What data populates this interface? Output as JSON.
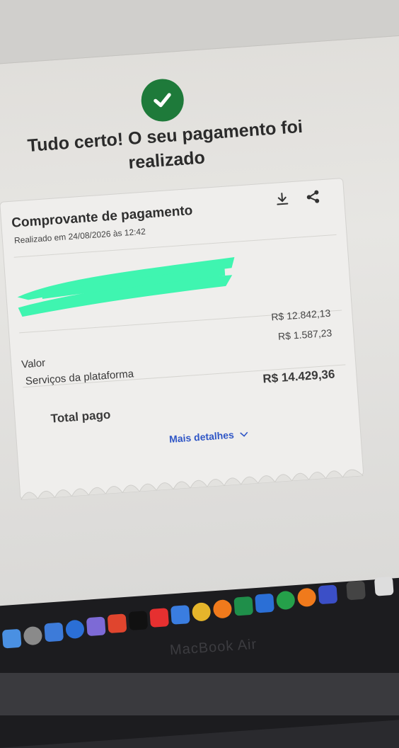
{
  "header": {
    "title": "Tudo certo! O seu pagamento foi realizado"
  },
  "receipt": {
    "title": "Comprovante de pagamento",
    "subtitle": "Realizado em 24/08/2026 às 12:42",
    "rows": [
      {
        "label": "Valor",
        "value": "R$ 12.842,13"
      },
      {
        "label": "Serviços da plataforma",
        "value": "R$ 1.587,23"
      }
    ],
    "total_label": "Total pago",
    "total_value": "R$ 14.429,36",
    "more_details": "Mais detalhes"
  },
  "laptop": {
    "brand": "MacBook Air"
  },
  "colors": {
    "success": "#1e7a3a",
    "link": "#2f56c6",
    "redaction": "#3ff5b0"
  },
  "icons": [
    "check-icon",
    "download-icon",
    "share-icon",
    "chevron-down-icon"
  ]
}
